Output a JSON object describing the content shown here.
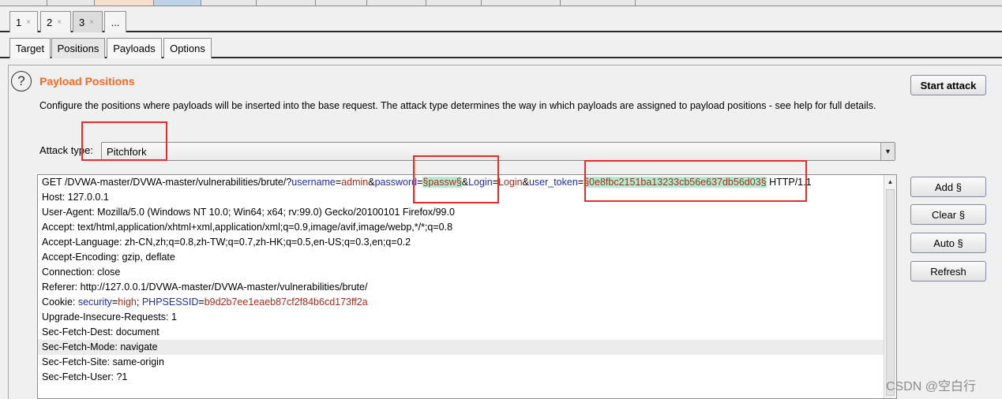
{
  "tabs": {
    "numbered": [
      {
        "label": "1",
        "close": "×"
      },
      {
        "label": "2",
        "close": "×"
      },
      {
        "label": "3",
        "close": "×"
      },
      {
        "label": "..."
      }
    ],
    "sub": [
      "Target",
      "Positions",
      "Payloads",
      "Options"
    ],
    "active_sub": "Positions"
  },
  "section": {
    "title": "Payload Positions",
    "description": "Configure the positions where payloads will be inserted into the base request. The attack type determines the way in which payloads are assigned to payload positions - see help for full details.",
    "help_icon": "?"
  },
  "attack": {
    "label": "Attack type:",
    "value": "Pitchfork"
  },
  "buttons": {
    "start": "Start attack",
    "add": "Add §",
    "clear": "Clear §",
    "auto": "Auto §",
    "refresh": "Refresh"
  },
  "request": {
    "line1": {
      "method_path": "GET /DVWA-master/DVWA-master/vulnerabilities/brute/?",
      "p1_key": "username",
      "eq": "=",
      "p1_val": "admin",
      "amp": "&",
      "p2_key": "password",
      "p2_val": "§passw§",
      "p3_key": "Login",
      "p3_val": "Login",
      "p4_key": "user_token",
      "p4_val": "§0e8fbc2151ba13233cb56e637db56d03§",
      "proto": " HTTP/1.1"
    },
    "host": "Host: 127.0.0.1",
    "user_agent": "User-Agent: Mozilla/5.0 (Windows NT 10.0; Win64; x64; rv:99.0) Gecko/20100101 Firefox/99.0",
    "accept": "Accept: text/html,application/xhtml+xml,application/xml;q=0.9,image/avif,image/webp,*/*;q=0.8",
    "accept_language": "Accept-Language: zh-CN,zh;q=0.8,zh-TW;q=0.7,zh-HK;q=0.5,en-US;q=0.3,en;q=0.2",
    "accept_encoding": "Accept-Encoding: gzip, deflate",
    "connection": "Connection: close",
    "referer": "Referer: http://127.0.0.1/DVWA-master/DVWA-master/vulnerabilities/brute/",
    "cookie": {
      "prefix": "Cookie: ",
      "k1": "security",
      "v1": "high",
      "sep": "; ",
      "k2": "PHPSESSID",
      "v2": "b9d2b7ee1eaeb87cf2f84b6cd173ff2a"
    },
    "upgrade": "Upgrade-Insecure-Requests: 1",
    "sec_dest": "Sec-Fetch-Dest: document",
    "sec_mode": "Sec-Fetch-Mode: navigate",
    "sec_site": "Sec-Fetch-Site: same-origin",
    "sec_user": "Sec-Fetch-User: ?1"
  },
  "watermark": "CSDN @空白行",
  "colors": {
    "title": "#f26a24",
    "param_key": "#1f2fa0",
    "param_value": "#a0301e",
    "payload_marker_bg": "#b4ead0",
    "annotation": "#e82c2c"
  }
}
